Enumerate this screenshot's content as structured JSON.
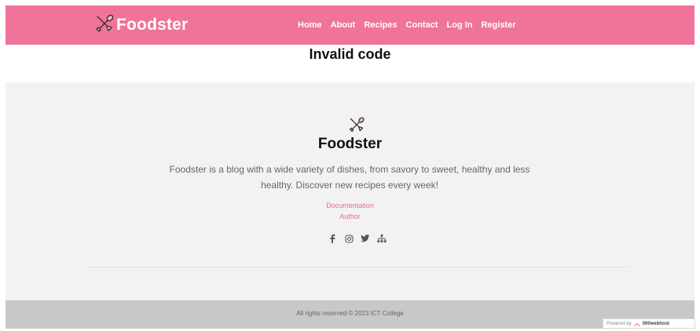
{
  "header": {
    "brand": "Foodster",
    "nav": [
      {
        "label": "Home"
      },
      {
        "label": "About"
      },
      {
        "label": "Recipes"
      },
      {
        "label": "Contact"
      },
      {
        "label": "Log In"
      },
      {
        "label": "Register"
      }
    ],
    "logo_icon": "utensils-crossed-icon"
  },
  "main": {
    "headline": "Invalid code"
  },
  "footer": {
    "logo_icon": "utensils-crossed-icon",
    "brand": "Foodster",
    "description": "Foodster is a blog with a wide variety of dishes, from savory to sweet, healthy and less healthy. Discover new recipes every week!",
    "links": [
      {
        "label": "Documentation"
      },
      {
        "label": "Author"
      }
    ],
    "social_icons": [
      "facebook-icon",
      "instagram-icon",
      "twitter-icon",
      "sitemap-icon"
    ],
    "copyright": "All rights reserved © 2023 ICT College"
  },
  "badge": {
    "prefix": "Powered by",
    "brand": "000webhost"
  },
  "colors": {
    "accent": "#f0739a",
    "link": "#e86a8f",
    "footer_bg": "#f2f2f2",
    "copyright_bg": "#c8c8c8"
  }
}
